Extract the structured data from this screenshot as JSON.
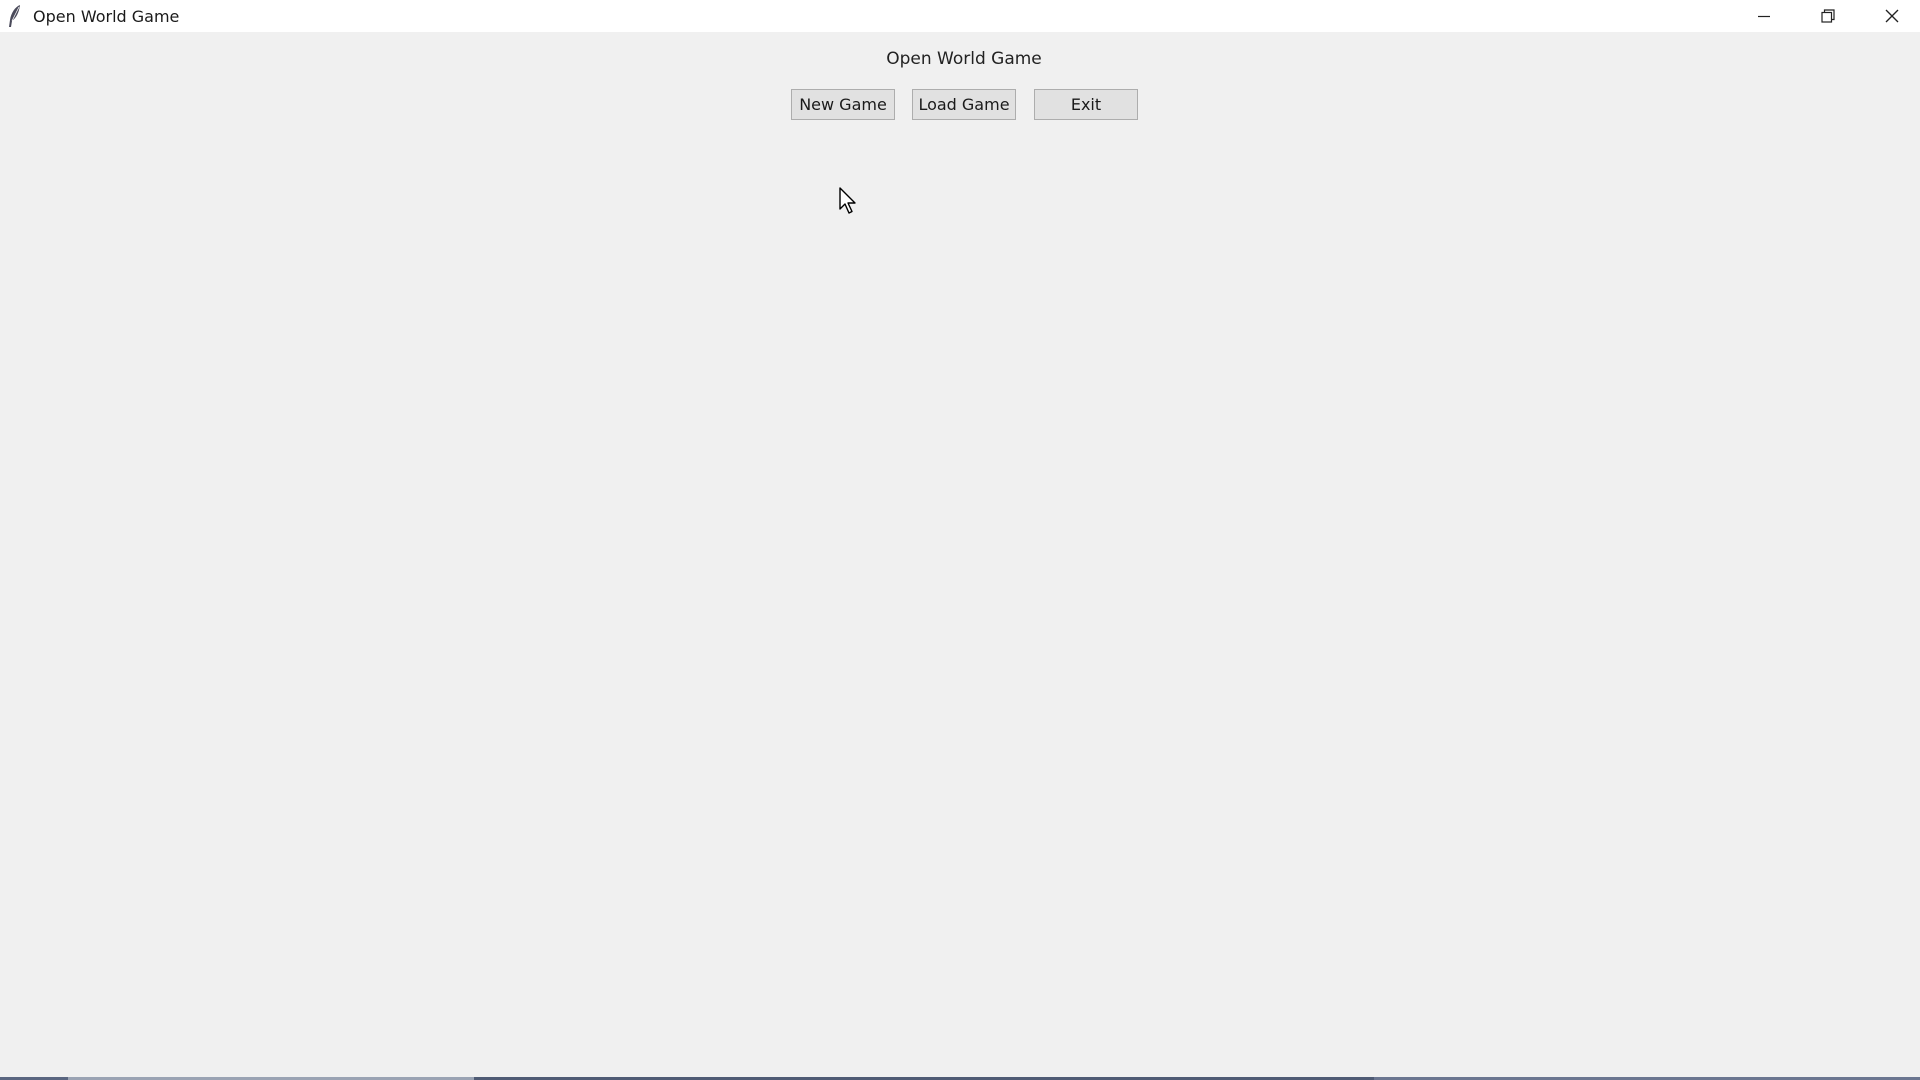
{
  "window": {
    "title": "Open World Game",
    "icon": "feather-icon",
    "controls": [
      "minimize-icon",
      "restore-icon",
      "close-icon"
    ]
  },
  "main": {
    "heading": "Open World Game",
    "buttons": {
      "new_game": "New Game",
      "load_game": "Load Game",
      "exit": "Exit"
    }
  },
  "colors": {
    "background": "#f0f0f0",
    "titlebar": "#ffffff",
    "button_face": "#e1e1e1",
    "button_border": "#adadad",
    "text": "#1a1a1a"
  }
}
